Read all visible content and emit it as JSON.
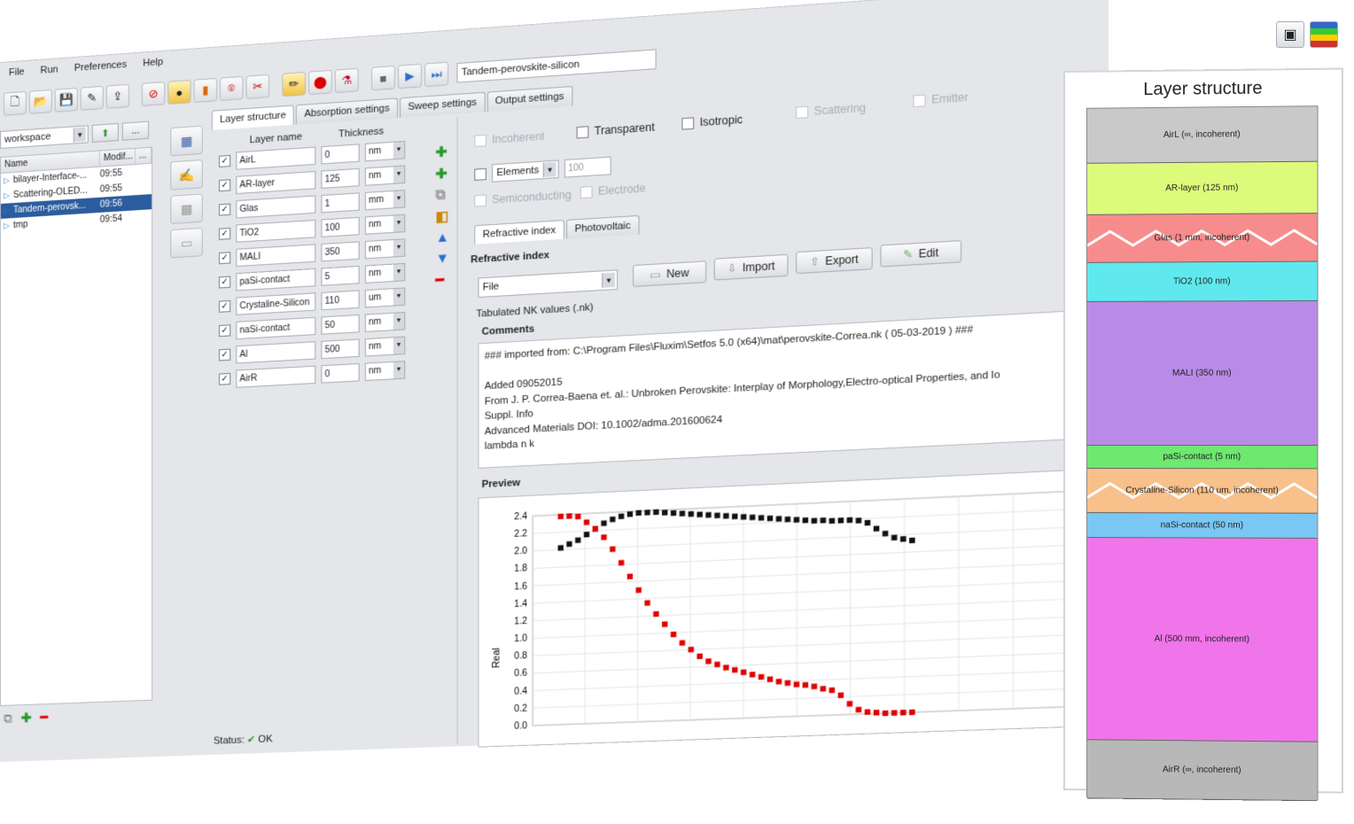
{
  "menu": [
    "File",
    "Run",
    "Preferences",
    "Help"
  ],
  "toolbar": {
    "document_title": "Tandem-perovskite-silicon"
  },
  "workspace": {
    "selector": "workspace",
    "up_icon": "arrow-up-icon",
    "browse_label": "...",
    "columns": [
      "Name",
      "Modif...",
      "..."
    ],
    "files": [
      {
        "name": "bilayer-Interface-...",
        "time": "09:55"
      },
      {
        "name": "Scattering-OLED...",
        "time": "09:55"
      },
      {
        "name": "Tandem-perovsk...",
        "time": "09:56"
      },
      {
        "name": "tmp",
        "time": "09:54"
      }
    ]
  },
  "tabs": [
    "Layer structure",
    "Absorption settings",
    "Sweep settings",
    "Output settings"
  ],
  "layer_table": {
    "col_name": "Layer name",
    "col_thickness": "Thickness",
    "rows": [
      {
        "name": "AirL",
        "thickness": "0",
        "unit": "nm",
        "checked": "✓"
      },
      {
        "name": "AR-layer",
        "thickness": "125",
        "unit": "nm",
        "checked": "✓"
      },
      {
        "name": "Glas",
        "thickness": "1",
        "unit": "mm",
        "checked": "✓"
      },
      {
        "name": "TiO2",
        "thickness": "100",
        "unit": "nm",
        "checked": "✓"
      },
      {
        "name": "MALI",
        "thickness": "350",
        "unit": "nm",
        "checked": "✓"
      },
      {
        "name": "paSi-contact",
        "thickness": "5",
        "unit": "nm",
        "checked": "✓"
      },
      {
        "name": "Crystaline-Silicon",
        "thickness": "110",
        "unit": "um",
        "checked": "✓"
      },
      {
        "name": "naSi-contact",
        "thickness": "50",
        "unit": "nm",
        "checked": "✓"
      },
      {
        "name": "Al",
        "thickness": "500",
        "unit": "nm",
        "checked": "✓"
      },
      {
        "name": "AirR",
        "thickness": "0",
        "unit": "nm",
        "checked": "✓"
      }
    ],
    "status_label": "Status:",
    "status_value": "OK"
  },
  "options": {
    "incoherent": "Incoherent",
    "transparent": "Transparent",
    "isotropic": "Isotropic",
    "scattering": "Scattering",
    "emitter": "Emitter",
    "elements": "Elements",
    "elements_value": "100",
    "semiconducting": "Semiconducting",
    "electrode": "Electrode"
  },
  "subtabs": [
    "Refractive index",
    "Photovoltaic"
  ],
  "refractive": {
    "section": "Refractive index",
    "source": "File",
    "buttons": {
      "new": "New",
      "import": "Import",
      "export": "Export",
      "edit": "Edit"
    },
    "tabulated": "Tabulated NK values (.nk)",
    "comments_title": "Comments",
    "comments": [
      "### imported from: C:\\Program Files\\Fluxim\\Setfos 5.0 (x64)\\mat\\perovskite-Correa.nk ( 05-03-2019 ) ###",
      "",
      "Added 09052015",
      "From J. P. Correa-Baena et. al.: Unbroken Perovskite: Interplay of Morphology,Electro-optical Properties, and Io",
      "Suppl. Info",
      "Advanced Materials DOI: 10.1002/adma.201600624",
      "lambda n k"
    ],
    "preview_title": "Preview"
  },
  "chart_data": {
    "type": "scatter",
    "ylabel": "Real",
    "ylim": [
      0.0,
      2.4
    ],
    "yticks": [
      "2.4",
      "2.2",
      "2.0",
      "1.8",
      "1.6",
      "1.4",
      "1.2",
      "1.0",
      "0.8",
      "0.6",
      "0.4",
      "0.2",
      "0.0"
    ],
    "x": [
      0,
      1,
      2,
      3,
      4,
      5,
      6,
      7,
      8,
      9,
      10,
      11,
      12,
      13,
      14,
      15,
      16,
      17,
      18,
      19,
      20,
      21,
      22,
      23,
      24,
      25,
      26,
      27,
      28,
      29,
      30,
      31,
      32,
      33,
      34,
      35,
      36,
      37,
      38,
      39,
      40
    ],
    "grid": true,
    "series": [
      {
        "color": "#111111",
        "values": [
          2.02,
          2.06,
          2.1,
          2.16,
          2.22,
          2.28,
          2.32,
          2.35,
          2.37,
          2.38,
          2.38,
          2.38,
          2.37,
          2.36,
          2.35,
          2.34,
          2.33,
          2.32,
          2.31,
          2.3,
          2.29,
          2.28,
          2.27,
          2.26,
          2.25,
          2.24,
          2.23,
          2.22,
          2.21,
          2.2,
          2.2,
          2.19,
          2.19,
          2.19,
          2.18,
          2.15,
          2.08,
          2.02,
          1.97,
          1.95,
          1.93
        ]
      },
      {
        "color": "#e00000",
        "values": [
          2.38,
          2.38,
          2.37,
          2.3,
          2.22,
          2.12,
          1.98,
          1.82,
          1.66,
          1.5,
          1.35,
          1.22,
          1.1,
          0.98,
          0.88,
          0.8,
          0.72,
          0.66,
          0.62,
          0.58,
          0.55,
          0.52,
          0.49,
          0.46,
          0.43,
          0.4,
          0.38,
          0.36,
          0.35,
          0.33,
          0.3,
          0.28,
          0.22,
          0.12,
          0.05,
          0.02,
          0.01,
          0.0,
          0.0,
          0.0,
          0.0
        ]
      }
    ]
  },
  "structure": {
    "title": "Layer structure",
    "layers": [
      {
        "label": "AirL (∞, incoherent)",
        "height": 62,
        "color": "#c9c9c9",
        "zigzag": false
      },
      {
        "label": "AR-layer (125 nm)",
        "height": 58,
        "color": "#dcfb7a",
        "zigzag": false
      },
      {
        "label": "Glas (1 mm, incoherent)",
        "height": 54,
        "color": "#f78c8c",
        "zigzag": true
      },
      {
        "label": "TiO2 (100 nm)",
        "height": 44,
        "color": "#5fe9ee",
        "zigzag": false
      },
      {
        "label": "MALI (350 nm)",
        "height": 162,
        "color": "#b98be6",
        "zigzag": false
      },
      {
        "label": "paSi-contact (5 nm)",
        "height": 26,
        "color": "#6fe86f",
        "zigzag": false
      },
      {
        "label": "Crystaline-Silicon (110 um, incoherent)",
        "height": 50,
        "color": "#f8c08a",
        "zigzag": true
      },
      {
        "label": "naSi-contact (50 nm)",
        "height": 28,
        "color": "#7ac7f3",
        "zigzag": false
      },
      {
        "label": "Al (500 mm, incoherent)",
        "height": 228,
        "color": "#f075ea",
        "zigzag": false
      },
      {
        "label": "AirR (∞, incoherent)",
        "height": 66,
        "color": "#b8b8b8",
        "zigzag": false
      }
    ]
  }
}
